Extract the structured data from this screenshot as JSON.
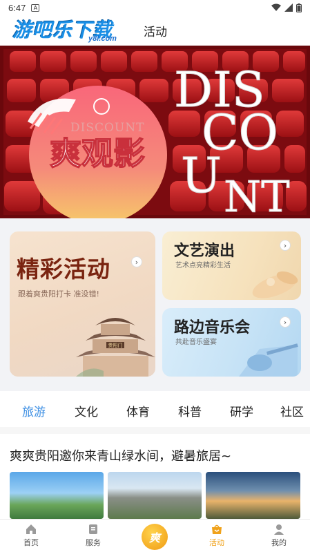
{
  "status_bar": {
    "time": "6:47",
    "badge": "A"
  },
  "header": {
    "logo_main": "游吧乐下载",
    "logo_sub": "y8l.com",
    "title": "活动"
  },
  "banner": {
    "title": "爽观影",
    "overlay_text": "DISCOUNT",
    "big_letters": [
      "DIS",
      "CO",
      "U",
      "NT"
    ]
  },
  "cards": {
    "big": {
      "title": "精彩活动",
      "subtitle": "跟着爽贵阳打卡  准没错!",
      "sign": "贵阳门"
    },
    "small": [
      {
        "title": "文艺演出",
        "subtitle": "艺术点亮精彩生活"
      },
      {
        "title": "路边音乐会",
        "subtitle": "共赴音乐盛宴"
      }
    ]
  },
  "tabs": [
    "旅游",
    "文化",
    "体育",
    "科普",
    "研学",
    "社区"
  ],
  "active_tab": 0,
  "article": {
    "headline": "爽爽贵阳邀你来青山绿水间，避暑旅居~"
  },
  "bottom_nav": {
    "items": [
      "首页",
      "服务",
      "",
      "活动",
      "我的"
    ],
    "center_glyph": "爽",
    "active": 3
  },
  "colors": {
    "accent": "#3b8ee3",
    "nav_active": "#f0a21a",
    "banner_red": "#8a0e12"
  }
}
